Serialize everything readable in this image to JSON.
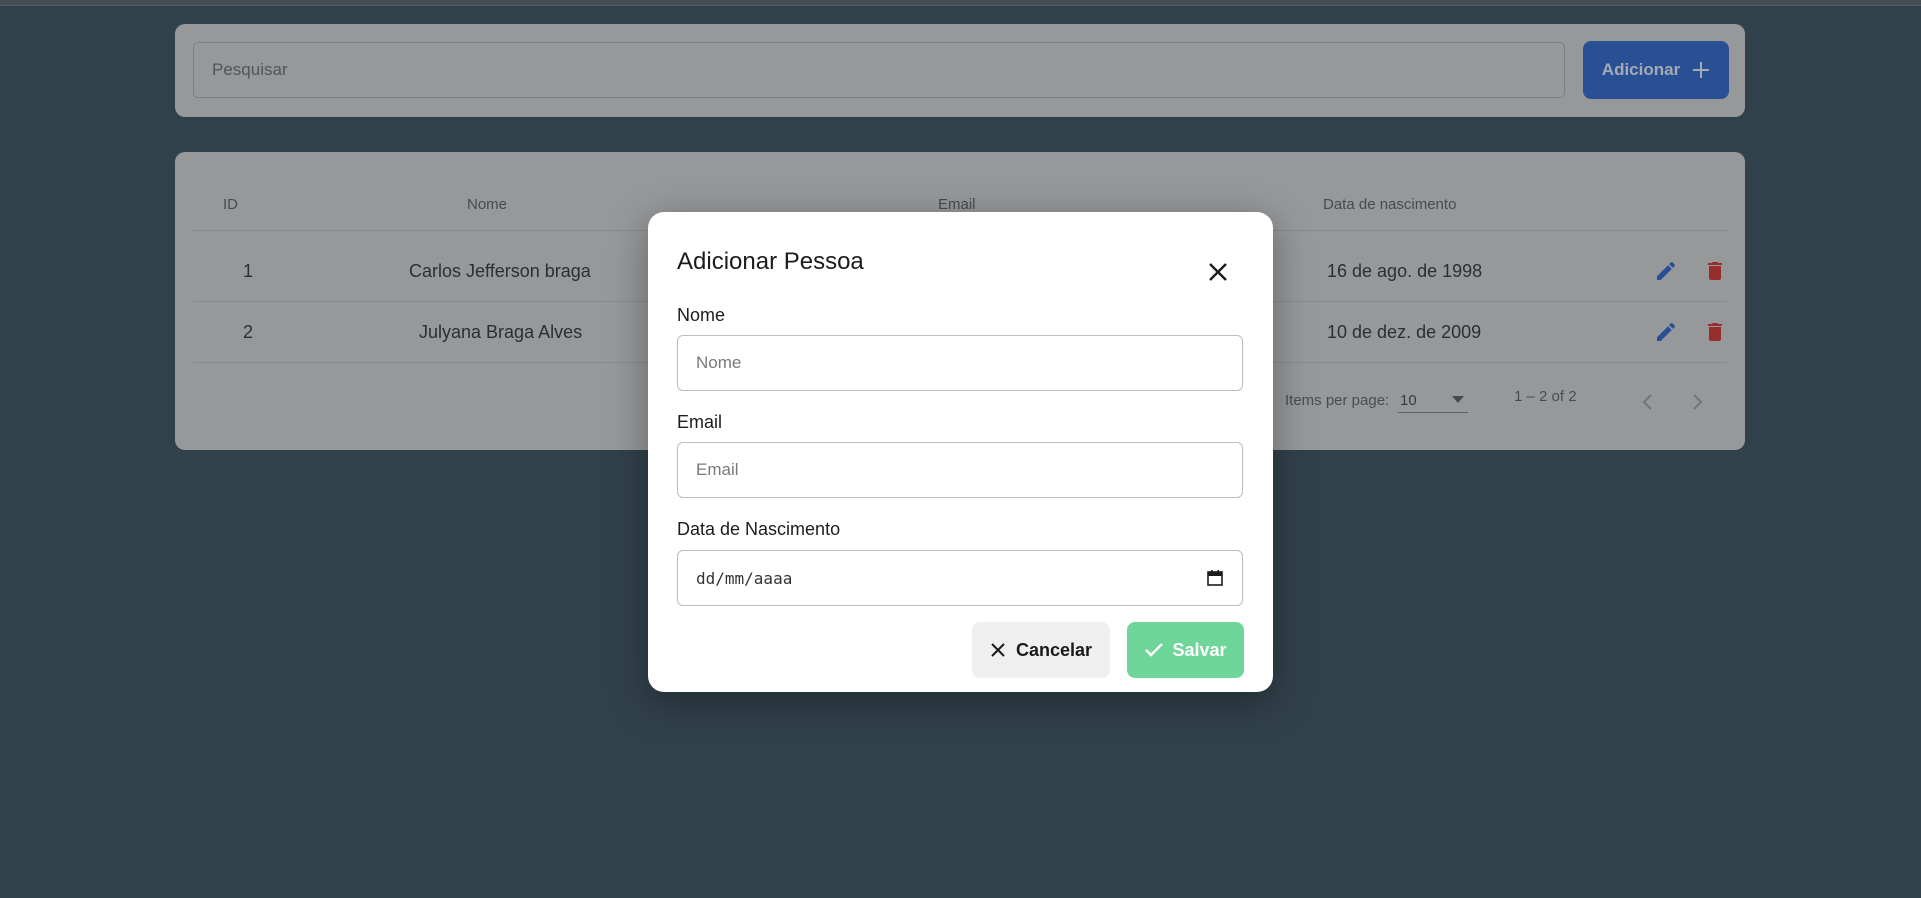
{
  "search": {
    "placeholder": "Pesquisar"
  },
  "add_button": {
    "label": "Adicionar"
  },
  "table": {
    "headers": {
      "id": "ID",
      "nome": "Nome",
      "email": "Email",
      "nascimento": "Data de nascimento"
    },
    "rows": [
      {
        "id": "1",
        "nome": "Carlos Jefferson braga",
        "nascimento": "16 de ago. de 1998"
      },
      {
        "id": "2",
        "nome": "Julyana Braga Alves",
        "nascimento": "10 de dez. de 2009"
      }
    ]
  },
  "paginator": {
    "items_per_page_label": "Items per page:",
    "page_size": "10",
    "range_label": "1 – 2 of 2"
  },
  "dialog": {
    "title": "Adicionar Pessoa",
    "nome_label": "Nome",
    "nome_placeholder": "Nome",
    "email_label": "Email",
    "email_placeholder": "Email",
    "nascimento_label": "Data de Nascimento",
    "date_placeholder": "dd/mm/aaaa",
    "cancel_label": "Cancelar",
    "save_label": "Salvar"
  },
  "colors": {
    "accent": "#2f63c8",
    "edit_icon": "#2f63c8",
    "delete_icon": "#d0312d",
    "save_button": "#6fd69a",
    "cancel_button": "#efefef"
  },
  "icons": [
    "plus-icon",
    "edit-icon",
    "delete-icon",
    "chevron-left-icon",
    "chevron-right-icon",
    "dropdown-arrow-icon",
    "close-icon",
    "calendar-icon",
    "check-icon"
  ]
}
